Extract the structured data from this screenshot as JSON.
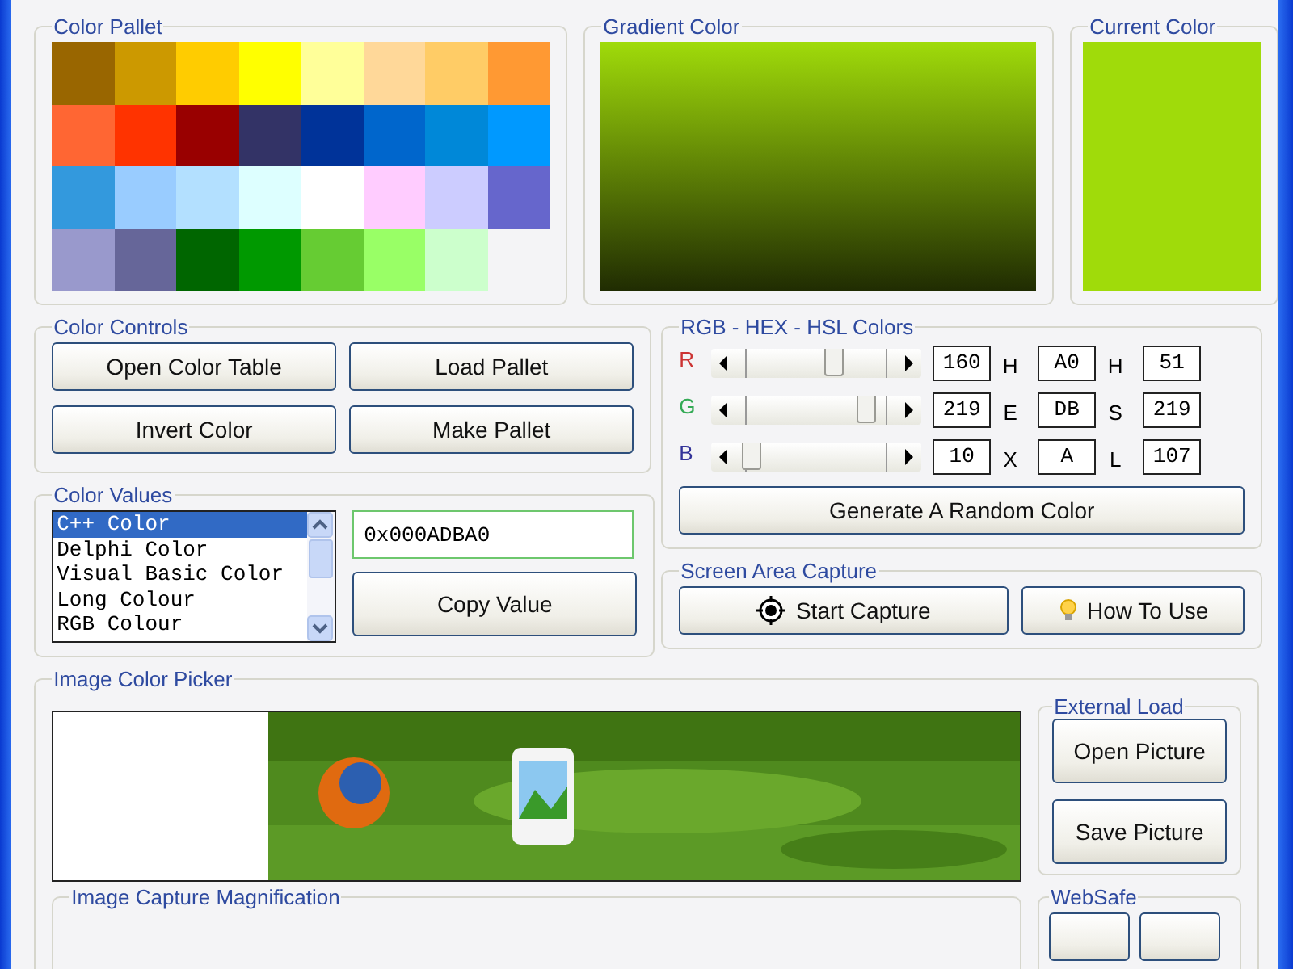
{
  "palette": {
    "title": "Color Pallet",
    "swatches": [
      {
        "color": "#996600"
      },
      {
        "color": "#cc9900"
      },
      {
        "color": "#ffcc00"
      },
      {
        "color": "#ffff00"
      },
      {
        "color": "#ffff99"
      },
      {
        "color": "#ffd899"
      },
      {
        "color": "#ffcc66"
      },
      {
        "color": "#ff9933"
      },
      {
        "color": "#ff6633"
      },
      {
        "color": "#ff3300"
      },
      {
        "color": "#990000"
      },
      {
        "color": "#333366"
      },
      {
        "color": "#003399"
      },
      {
        "color": "#0066cc"
      },
      {
        "color": "#0088d8"
      },
      {
        "color": "#0099ff"
      },
      {
        "color": "#3399dd"
      },
      {
        "color": "#99ccff"
      },
      {
        "color": "#b3e0ff"
      },
      {
        "color": "#ddffff"
      },
      {
        "color": "#ffffff"
      },
      {
        "color": "#ffccff"
      },
      {
        "color": "#ccccff"
      },
      {
        "color": "#6666cc"
      },
      {
        "color": "#9999cc"
      },
      {
        "color": "#666699"
      },
      {
        "color": "#006600"
      },
      {
        "color": "#009900"
      },
      {
        "color": "#66cc33"
      },
      {
        "color": "#99ff66"
      },
      {
        "color": "#ccffcc"
      }
    ]
  },
  "gradient": {
    "title": "Gradient Color"
  },
  "current": {
    "title": "Current Color"
  },
  "controls": {
    "title": "Color Controls",
    "buttons": [
      "Open Color Table",
      "Load Pallet",
      "Invert Color",
      "Make Pallet"
    ]
  },
  "rgb": {
    "title": "RGB - HEX - HSL Colors",
    "channels": [
      {
        "letter": "R",
        "color": "#cc3333",
        "level": 0.627,
        "value": "160",
        "hex_letter": "H",
        "hex": "A0",
        "hsl_letter": "H",
        "hsl": "51"
      },
      {
        "letter": "G",
        "color": "#33aa55",
        "level": 0.859,
        "value": "219",
        "hex_letter": "E",
        "hex": "DB",
        "hsl_letter": "S",
        "hsl": "219"
      },
      {
        "letter": "B",
        "color": "#333399",
        "level": 0.039,
        "value": "10",
        "hex_letter": "X",
        "hex": "A",
        "hsl_letter": "L",
        "hsl": "107"
      }
    ],
    "random_button": "Generate A Random Color"
  },
  "values": {
    "title": "Color Values",
    "formats": [
      {
        "label": "C++ Color",
        "selected": true
      },
      {
        "label": "Delphi Color",
        "selected": false
      },
      {
        "label": "Visual Basic Color",
        "selected": false
      },
      {
        "label": "Long Colour",
        "selected": false
      },
      {
        "label": "RGB Colour",
        "selected": false
      }
    ],
    "value": "0x000ADBA0",
    "copy_button": "Copy Value"
  },
  "capture": {
    "title": "Screen Area Capture",
    "buttons": [
      {
        "label": "Start Capture",
        "kind": "target"
      },
      {
        "label": "How To Use",
        "kind": "bulb"
      }
    ]
  },
  "picker": {
    "title": "Image Color Picker",
    "external": {
      "title": "External Load",
      "buttons": [
        "Open Picture",
        "Save Picture"
      ]
    },
    "magnification": {
      "title": "Image Capture Magnification"
    },
    "websafe": {
      "title": "WebSafe"
    }
  }
}
